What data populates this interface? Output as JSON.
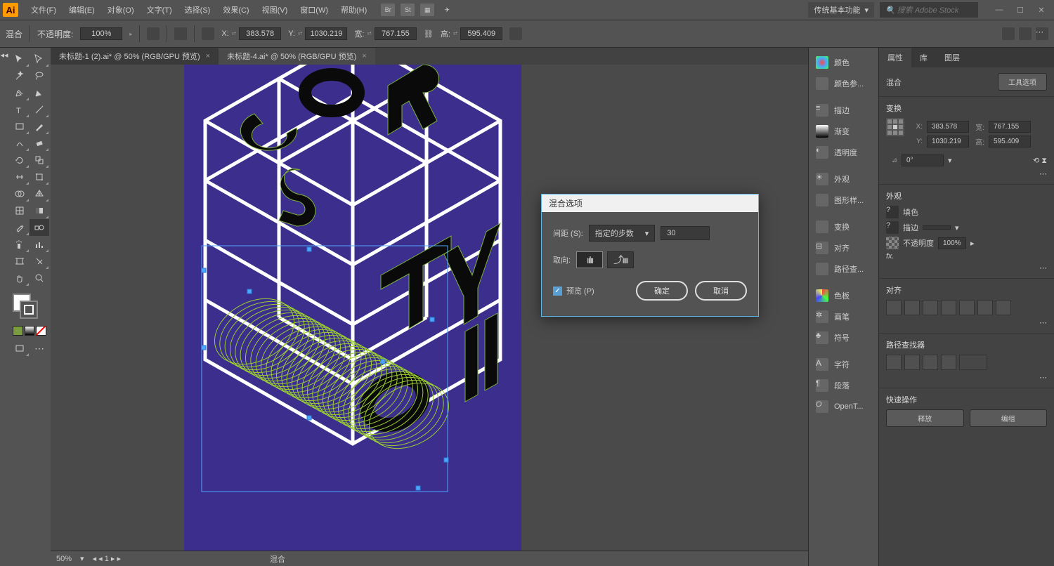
{
  "app": {
    "logo": "Ai"
  },
  "menu": [
    "文件(F)",
    "编辑(E)",
    "对象(O)",
    "文字(T)",
    "选择(S)",
    "效果(C)",
    "视图(V)",
    "窗口(W)",
    "帮助(H)"
  ],
  "workspace": {
    "name": "传统基本功能",
    "search_placeholder": "搜索 Adobe Stock"
  },
  "control": {
    "mode": "混合",
    "opacity_label": "不透明度:",
    "opacity": "100%",
    "x_label": "X:",
    "x": "383.578",
    "y_label": "Y:",
    "y": "1030.219",
    "w_label": "宽:",
    "w": "767.155",
    "h_label": "高:",
    "h": "595.409"
  },
  "tabs": [
    {
      "label": "未标题-1 (2).ai* @ 50% (RGB/GPU 预览)",
      "active": false
    },
    {
      "label": "未标题-4.ai* @ 50% (RGB/GPU 预览)",
      "active": true
    }
  ],
  "status": {
    "zoom": "50%",
    "page": "1",
    "mode": "混合"
  },
  "rightcol": {
    "items1": [
      "颜色",
      "颜色参..."
    ],
    "items2": [
      "描边",
      "渐变",
      "透明度"
    ],
    "items3": [
      "外观",
      "图形样..."
    ],
    "items4": [
      "变换",
      "对齐",
      "路径查..."
    ],
    "items5": [
      "色板",
      "画笔",
      "符号"
    ],
    "items6": [
      "字符",
      "段落",
      "OpenT..."
    ]
  },
  "props": {
    "tabs": [
      "属性",
      "库",
      "图层"
    ],
    "sel": "混合",
    "tool_opts": "工具选项",
    "transform": {
      "title": "变换",
      "x": "383.578",
      "y": "1030.219",
      "w": "767.155",
      "h": "595.409",
      "angle": "0°"
    },
    "appearance": {
      "title": "外观",
      "fill": "填色",
      "stroke": "描边",
      "opacity_label": "不透明度",
      "opacity": "100%"
    },
    "align": {
      "title": "对齐"
    },
    "pathfinder": {
      "title": "路径查找器"
    },
    "quick": {
      "title": "快速操作",
      "release": "释放",
      "group": "编组"
    }
  },
  "dialog": {
    "title": "混合选项",
    "spacing_label": "间距 (S):",
    "spacing_mode": "指定的步数",
    "spacing_value": "30",
    "orient_label": "取向:",
    "preview": "预览 (P)",
    "ok": "确定",
    "cancel": "取消"
  }
}
